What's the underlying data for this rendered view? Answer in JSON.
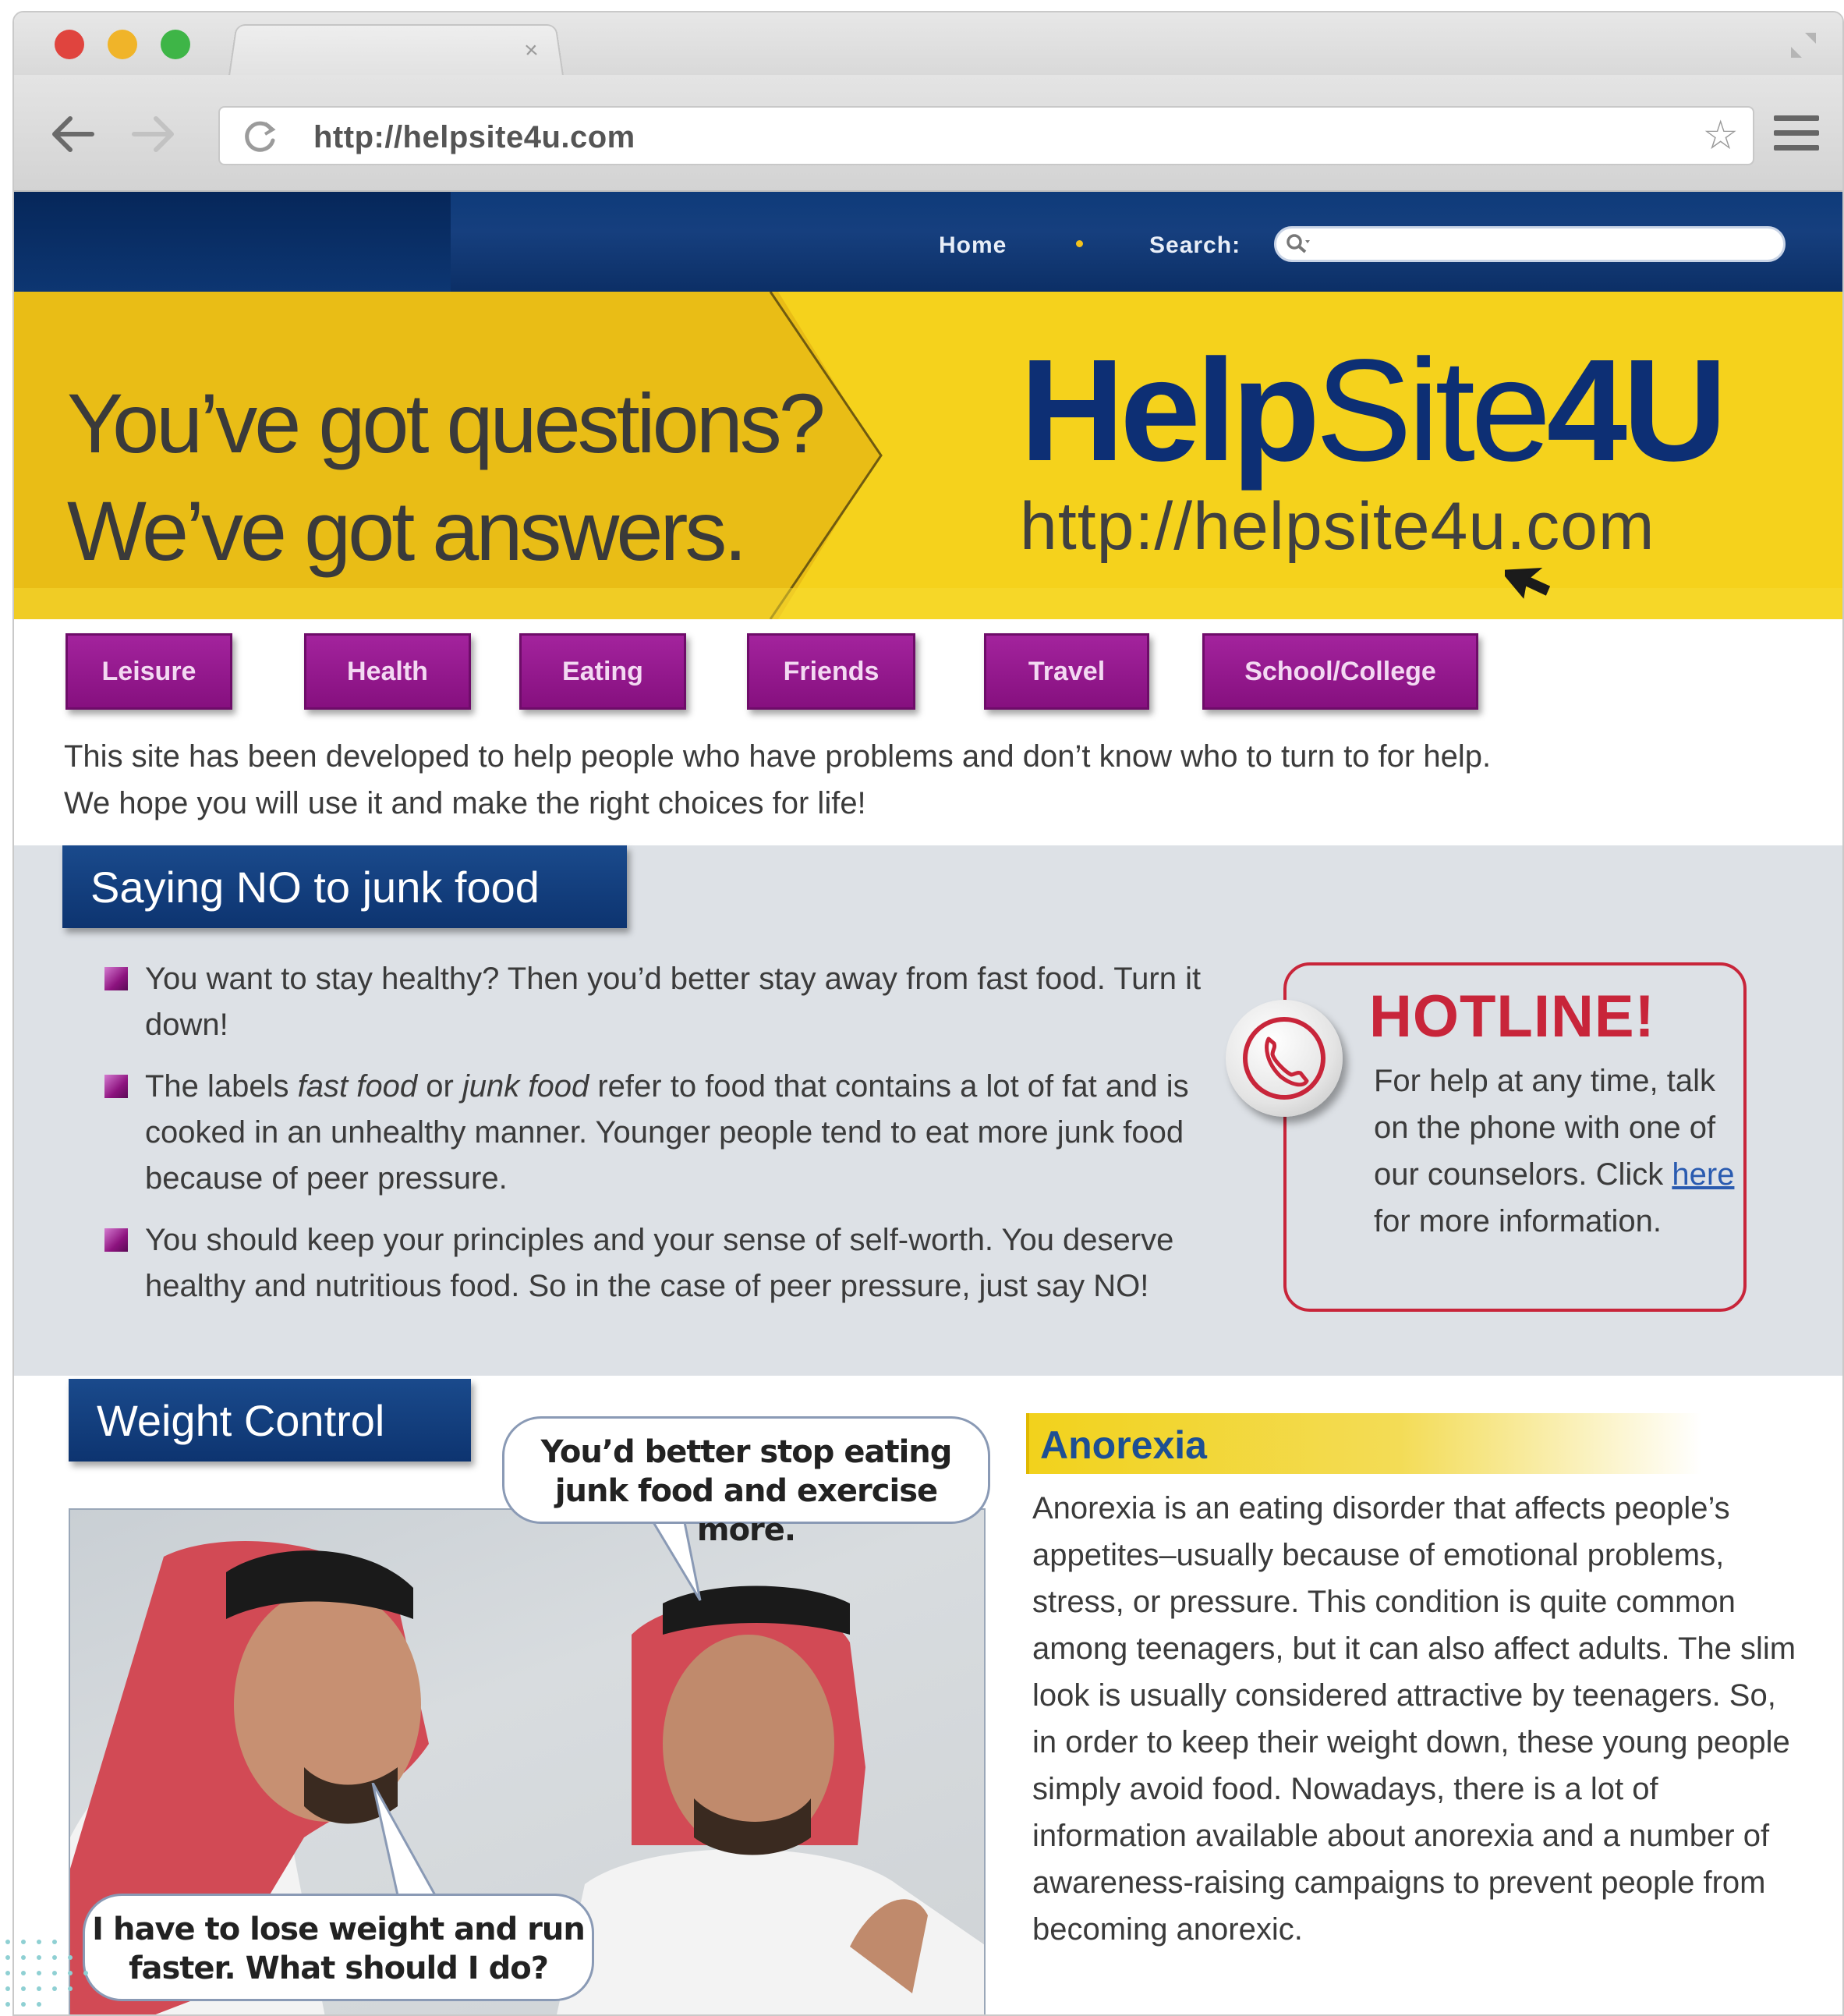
{
  "browser": {
    "url": "http://helpsite4u.com"
  },
  "site_nav": {
    "home": "Home",
    "search_label": "Search:"
  },
  "banner": {
    "tagline_line1": "You’ve got questions?",
    "tagline_line2": "We’ve got answers.",
    "brand_bold1": "Help",
    "brand_thin": "Site",
    "brand_bold2": "4U",
    "brand_url": "http://helpsite4u.com"
  },
  "categories": [
    "Leisure",
    "Health",
    "Eating",
    "Friends",
    "Travel",
    "School/College"
  ],
  "intro": {
    "line1": "This site has been developed to help people who have problems and don’t know who to turn to for help.",
    "line2": "We hope you will use it and make the right choices for life!"
  },
  "junk_food": {
    "title": "Saying NO to junk food",
    "bullet1": "You want to stay healthy? Then you’d better stay away from fast food. Turn it down!",
    "bullet2_a": "The labels ",
    "bullet2_em1": "fast food",
    "bullet2_b": " or ",
    "bullet2_em2": "junk food",
    "bullet2_c": " refer to food that contains a lot of fat and is cooked in an unhealthy manner. Younger people tend to eat more junk food because of peer pressure.",
    "bullet3": "You should keep your principles and your sense of self-worth. You deserve healthy and nutritious food. So in the case of peer pressure, just say NO!"
  },
  "hotline": {
    "title": "HOTLINE!",
    "text_a": "For help at any time, talk on the phone with one of our counselors. Click ",
    "link": "here",
    "text_b": " for more information."
  },
  "weight_control": {
    "title": "Weight Control",
    "bubble_top": "You’d better stop eating junk food and exercise more.",
    "bubble_bottom": "I have to lose weight and run faster. What should I do?"
  },
  "anorexia": {
    "title": "Anorexia",
    "text": "Anorexia is an eating disorder that affects people’s appetites–usually because of emotional problems, stress, or pressure. This condition is quite common among teenagers, but it can also affect adults.  The slim look is usually considered attractive by teenagers. So, in order to keep their weight down, these young people simply avoid food. Nowadays, there is a lot of information available about anorexia and a number of awareness-raising campaigns to prevent people from becoming anorexic."
  },
  "colors": {
    "nav_blue": "#0d3470",
    "banner_yellow": "#f5d21c",
    "category_purple": "#8d137f",
    "hotline_red": "#c8253a"
  }
}
